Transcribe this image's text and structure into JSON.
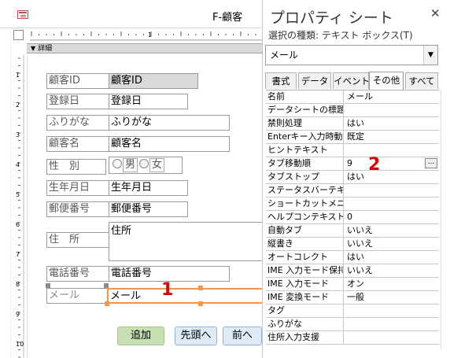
{
  "form": {
    "title": "F-顧客",
    "section_label": "詳細",
    "hruler_label": "1",
    "vruler": [
      "1",
      "2",
      "3",
      "4",
      "5",
      "6",
      "7",
      "8",
      "9",
      "10"
    ],
    "fields": {
      "id": {
        "label": "顧客ID",
        "value": "顧客ID"
      },
      "registered": {
        "label": "登録日",
        "value": "登録日"
      },
      "furigana": {
        "label": "ふりがな",
        "value": "ふりがな"
      },
      "name": {
        "label": "顧客名",
        "value": "顧客名"
      },
      "gender": {
        "label": "性　別",
        "opt_male": "男",
        "opt_female": "女"
      },
      "birthday": {
        "label": "生年月日",
        "value": "生年月日"
      },
      "postal": {
        "label": "郵便番号",
        "value": "郵便番号"
      },
      "address": {
        "label": "住　所",
        "value": "住所"
      },
      "phone": {
        "label": "電話番号",
        "value": "電話番号"
      },
      "mail": {
        "label": "メール",
        "value": "メール"
      }
    },
    "buttons": {
      "add": "追加",
      "first": "先頭へ",
      "prev": "前へ"
    }
  },
  "annotations": {
    "one": "1",
    "two": "2"
  },
  "property_sheet": {
    "title": "プロパティ シート",
    "close": "✕",
    "selection_type": "選択の種類:  テキスト ボックス(T)",
    "selected_control": "メール",
    "combo_arrow": "▼",
    "tabs": [
      "書式",
      "データ",
      "イベント",
      "その他",
      "すべて"
    ],
    "active_tab": "その他",
    "ellipsis": "...",
    "rows": [
      {
        "k": "名前",
        "v": "メール"
      },
      {
        "k": "データシートの標題",
        "v": ""
      },
      {
        "k": "禁則処理",
        "v": "はい"
      },
      {
        "k": "Enterキー入力時動作",
        "v": "既定"
      },
      {
        "k": "ヒントテキスト",
        "v": ""
      },
      {
        "k": "タブ移動順",
        "v": "9"
      },
      {
        "k": "タブストップ",
        "v": "はい"
      },
      {
        "k": "ステータスバーテキスト",
        "v": ""
      },
      {
        "k": "ショートカットメニュー",
        "v": ""
      },
      {
        "k": "ヘルプコンテキストID",
        "v": "0"
      },
      {
        "k": "自動タブ",
        "v": "いいえ"
      },
      {
        "k": "縦書き",
        "v": "いいえ"
      },
      {
        "k": "オートコレクト",
        "v": "はい"
      },
      {
        "k": "IME 入力モード保持",
        "v": "いいえ"
      },
      {
        "k": "IME 入力モード",
        "v": "オン"
      },
      {
        "k": "IME 変換モード",
        "v": "一般"
      },
      {
        "k": "タグ",
        "v": ""
      },
      {
        "k": "ふりがな",
        "v": ""
      },
      {
        "k": "住所入力支援",
        "v": ""
      }
    ]
  },
  "colors": {
    "accent_orange": "#f79646",
    "annotation_red": "#e00000",
    "add_button": "#c6e0b4",
    "nav_button": "#deebf7"
  }
}
